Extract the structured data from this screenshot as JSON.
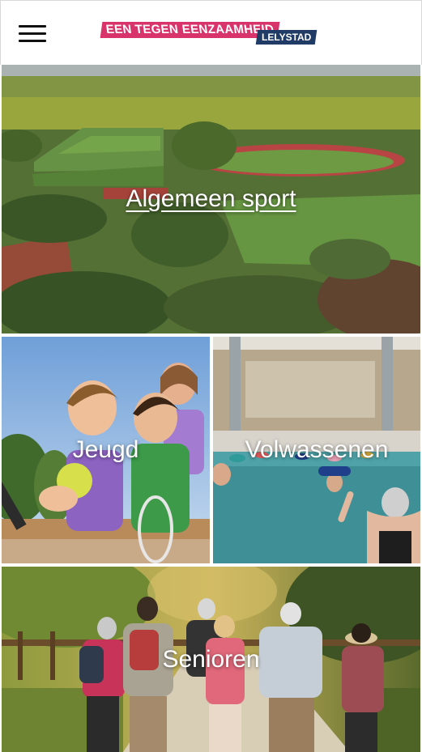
{
  "header": {
    "menu_icon": "hamburger-menu-icon",
    "logo": {
      "word1": "EEN",
      "word2": "TEGEN",
      "word3": "EENZAAMHEID",
      "city": "LELYSTAD"
    }
  },
  "tiles": [
    {
      "label": "Algemeen sport",
      "underlined": true
    },
    {
      "label": "Jeugd",
      "underlined": false
    },
    {
      "label": "Volwassenen",
      "underlined": false
    },
    {
      "label": "Senioren",
      "underlined": false
    }
  ],
  "colors": {
    "logo_pink": "#d9336b",
    "logo_navy": "#1f3b66",
    "header_bg": "#ffffff",
    "label_text": "#ffffff"
  }
}
